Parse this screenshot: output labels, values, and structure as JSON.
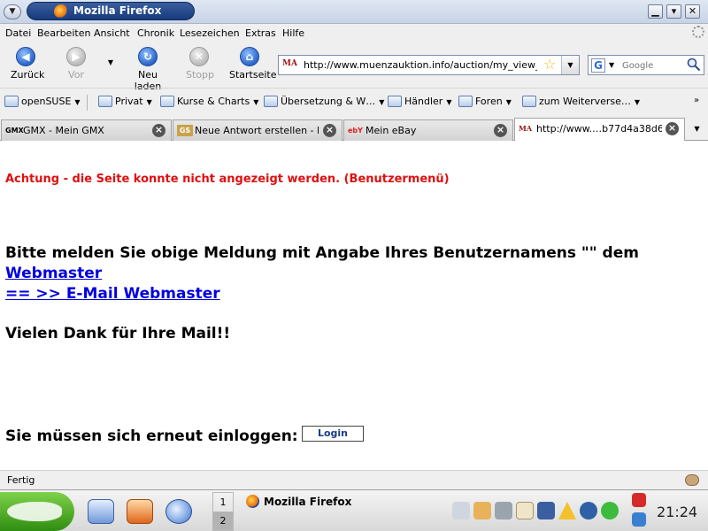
{
  "window": {
    "title": "Mozilla Firefox"
  },
  "menubar": [
    "Datei",
    "Bearbeiten",
    "Ansicht",
    "Chronik",
    "Lesezeichen",
    "Extras",
    "Hilfe"
  ],
  "navbar": {
    "back": "Zurück",
    "forward": "Vor",
    "reload": "Neu laden",
    "stop": "Stopp",
    "home": "Startseite",
    "url": "http://www.muenzauktion.info/auction/my_view_list.ph",
    "url_favicon": "MA",
    "search_placeholder": "Google",
    "search_engine": "G"
  },
  "bookmarks": [
    "openSUSE",
    "Privat",
    "Kurse & Charts",
    "Übersetzung & W…",
    "Händler",
    "Foren",
    "zum Weiterverse…"
  ],
  "tabs": [
    {
      "favicon": "GMX",
      "label": "GMX - Mein GMX"
    },
    {
      "favicon": "GS",
      "label": "Neue Antwort erstellen - E…"
    },
    {
      "favicon": "ebY",
      "label": "Mein eBay"
    },
    {
      "favicon": "MA",
      "label": "http://www.…b77d4a38d67"
    }
  ],
  "content": {
    "error": "Achtung - die Seite konnte nicht angezeigt werden. (Benutzermenü)",
    "message": "Bitte melden Sie obige Meldung mit Angabe Ihres Benutzernamens \"\" dem",
    "webmaster_link": "Webmaster",
    "email_link": "== >> E-Mail Webmaster",
    "thanks": "Vielen Dank für Ihre Mail!!",
    "relogin": "Sie müssen sich erneut einloggen:",
    "login_button": "Login"
  },
  "status": {
    "text": "Fertig"
  },
  "taskbar": {
    "desktops": [
      "1",
      "2"
    ],
    "task": "Mozilla Firefox",
    "clock": "21:24"
  },
  "colors": {
    "error_red": "#e01010",
    "link_blue": "#0000e0",
    "suse_green": "#3e9b1c",
    "titlebar_blue": "#163a7b"
  }
}
